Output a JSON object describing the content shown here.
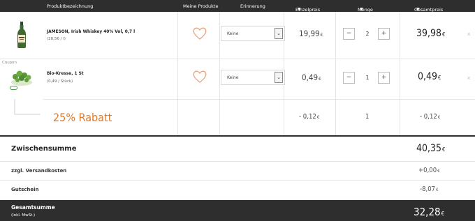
{
  "header": {
    "product": "Produktbezeichnung",
    "my_products": "Meine Produkte",
    "reminder": "Erinnerung",
    "unit_price": "Einzelpreis",
    "quantity": "Menge",
    "total_price": "Gesamtpreis",
    "sort_arrow": "▼"
  },
  "items": [
    {
      "name": "JAMESON, Irish Whiskey 40% Vol, 0,7 l",
      "sub": "(28,56 / l)",
      "reminder": "Keine",
      "unit_price": "19,99",
      "quantity": "2",
      "total": "39,98",
      "currency": "€",
      "minus": "−",
      "plus": "+",
      "remove": "x"
    },
    {
      "name": "Bio-Kresse, 1 St",
      "sub": "(0,49 / Stück)",
      "reminder": "Keine",
      "unit_price": "0,49",
      "quantity": "1",
      "total": "0,49",
      "currency": "€",
      "minus": "−",
      "plus": "+",
      "remove": "x",
      "coupon_label": "Coupon"
    }
  ],
  "discount": {
    "label": "25% Rabatt",
    "unit": "- 0,12",
    "quantity": "1",
    "total": "- 0,12",
    "currency": "€"
  },
  "summary": {
    "subtotal_label": "Zwischensumme",
    "subtotal": "40,35",
    "shipping_label": "zzgl. Versandkosten",
    "shipping": "+0,00",
    "voucher_label": "Gutschein",
    "voucher": "-8,07",
    "grand_label": "Gesamtsumme",
    "grand_sub": "(inkl. MwSt.)",
    "grand": "32,28",
    "currency": "€"
  },
  "colors": {
    "header_bg": "#2e2e2e",
    "accent": "#e07b2c",
    "heart": "#e8a07a"
  }
}
